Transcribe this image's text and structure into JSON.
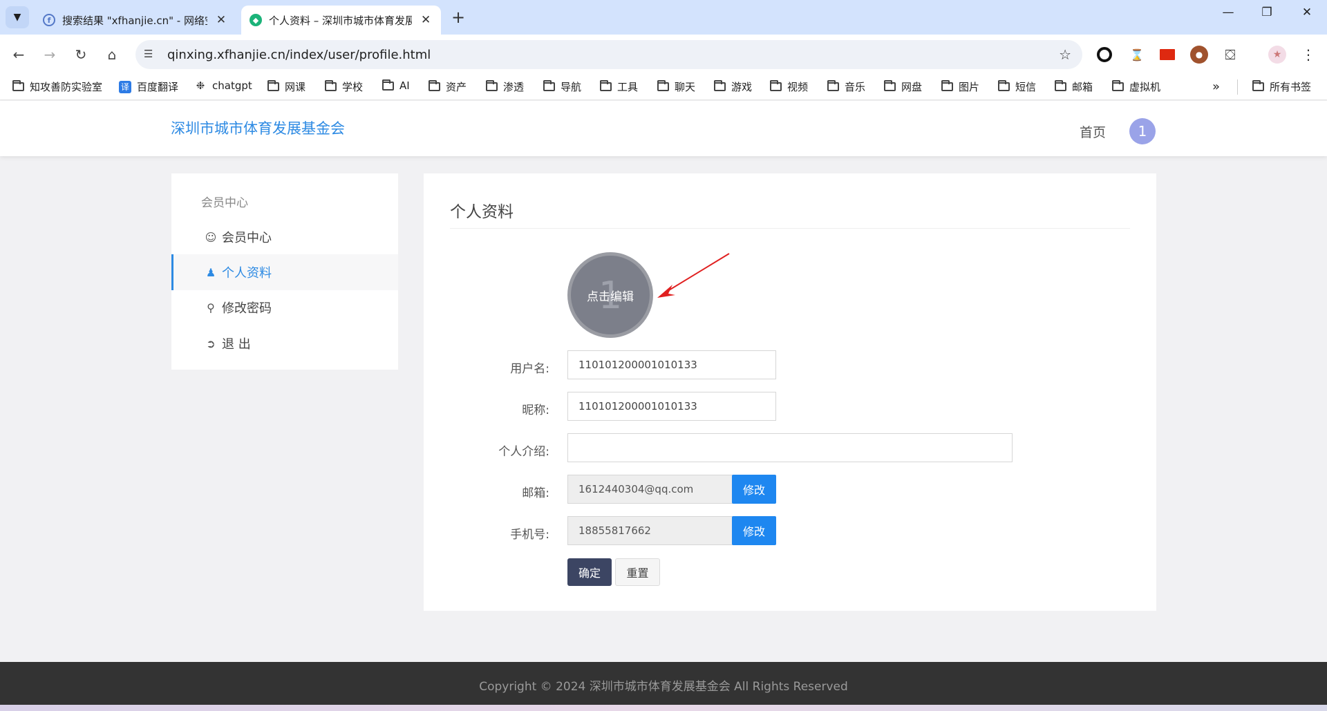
{
  "browser": {
    "tabs": [
      {
        "title": "搜索结果 \"xfhanjie.cn\" - 网络空间",
        "active": false
      },
      {
        "title": "个人资料 – 深圳市城市体育发展基金会",
        "active": true
      }
    ],
    "url": "qinxing.xfhanjie.cn/index/user/profile.html",
    "bookmarks": [
      {
        "label": "知攻善防实验室",
        "icon": "folder-icon"
      },
      {
        "label": "百度翻译",
        "icon": "translate-icon"
      },
      {
        "label": "chatgpt",
        "icon": "chatgpt-icon"
      },
      {
        "label": "网课",
        "icon": "folder-icon"
      },
      {
        "label": "学校",
        "icon": "folder-icon"
      },
      {
        "label": "AI",
        "icon": "folder-icon"
      },
      {
        "label": "资产",
        "icon": "folder-icon"
      },
      {
        "label": "渗透",
        "icon": "folder-icon"
      },
      {
        "label": "导航",
        "icon": "folder-icon"
      },
      {
        "label": "工具",
        "icon": "folder-icon"
      },
      {
        "label": "聊天",
        "icon": "folder-icon"
      },
      {
        "label": "游戏",
        "icon": "folder-icon"
      },
      {
        "label": "视频",
        "icon": "folder-icon"
      },
      {
        "label": "音乐",
        "icon": "folder-icon"
      },
      {
        "label": "网盘",
        "icon": "folder-icon"
      },
      {
        "label": "图片",
        "icon": "folder-icon"
      },
      {
        "label": "短信",
        "icon": "folder-icon"
      },
      {
        "label": "邮箱",
        "icon": "folder-icon"
      },
      {
        "label": "虚拟机",
        "icon": "folder-icon"
      }
    ],
    "all_bookmarks": "所有书签",
    "translate_glyph": "译"
  },
  "header": {
    "site_title": "深圳市城市体育发展基金会",
    "nav_home": "首页",
    "avatar_text": "1"
  },
  "sidebar": {
    "heading": "会员中心",
    "items": [
      {
        "label": "会员中心",
        "icon": "user-circle-icon",
        "active": false
      },
      {
        "label": "个人资料",
        "icon": "user-icon",
        "active": true
      },
      {
        "label": "修改密码",
        "icon": "key-icon",
        "active": false
      },
      {
        "label": "退 出",
        "icon": "sign-out-icon",
        "active": false
      }
    ]
  },
  "profile": {
    "title": "个人资料",
    "avatar_text": "1",
    "avatar_edit_label": "点击编辑",
    "fields": {
      "username": {
        "label": "用户名:",
        "value": "110101200001010133"
      },
      "nickname": {
        "label": "昵称:",
        "value": "110101200001010133"
      },
      "bio": {
        "label": "个人介绍:",
        "value": ""
      },
      "email": {
        "label": "邮箱:",
        "value": "1612440304@qq.com",
        "action": "修改"
      },
      "phone": {
        "label": "手机号:",
        "value": "18855817662",
        "action": "修改"
      }
    },
    "confirm_label": "确定",
    "reset_label": "重置"
  },
  "footer": {
    "text": "Copyright © 2024 深圳市城市体育发展基金会 All Rights Reserved"
  },
  "colors": {
    "accent": "#2d8ae3",
    "primary_button": "#1e87f0",
    "confirm_button": "#3c4563",
    "footer_bg": "#333333",
    "annotation_arrow": "#e02020"
  }
}
